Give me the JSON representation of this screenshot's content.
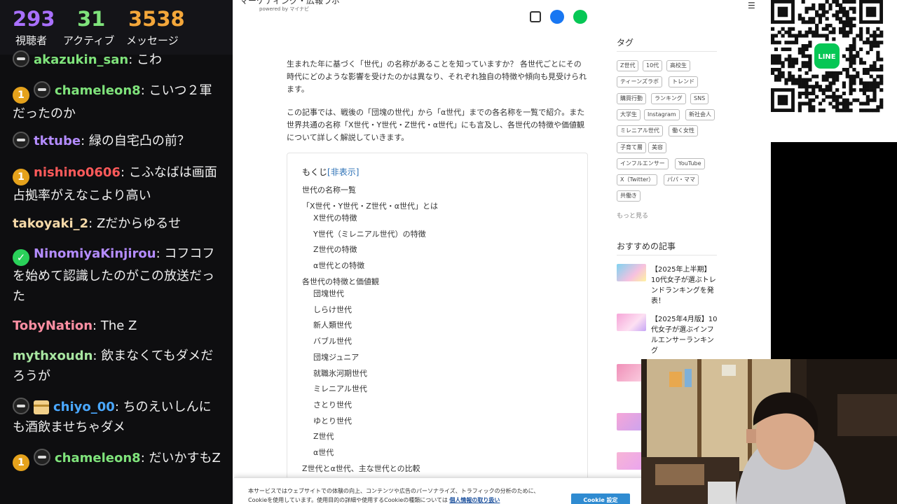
{
  "stats": [
    {
      "value": "293",
      "label": "視聴者",
      "color": "#a970ff"
    },
    {
      "value": "31",
      "label": "アクティブ",
      "color": "#7fe37b"
    },
    {
      "value": "3538",
      "label": "メッセージ",
      "color": "#f4a73a"
    }
  ],
  "chat": [
    {
      "badges": [
        "ninja-icon"
      ],
      "user": "akazukin_san",
      "color": "#7fe37b",
      "text": ": こわ"
    },
    {
      "badges": [
        "one-badge-icon",
        "ninja-icon"
      ],
      "user": "chameleon8",
      "color": "#7fe37b",
      "text": ": こいつ２軍だったのか"
    },
    {
      "badges": [
        "ninja-icon"
      ],
      "user": "tktube",
      "color": "#b48cff",
      "text": ": 緑の自宅凸の前？"
    },
    {
      "badges": [
        "one-badge-icon"
      ],
      "user": "nishino0606",
      "color": "#ff5a5a",
      "text": ": こふなばは画面占拠率がえなこより高い"
    },
    {
      "badges": [],
      "user": "takoyaki_2",
      "color": "#f5d9a8",
      "text": ": Zだからゆるせ"
    },
    {
      "badges": [
        "verified-badge-icon"
      ],
      "user": "NinomiyaKinjirou",
      "color": "#b48cff",
      "text": ": コフコフを始めて認識したのがこの放送だった"
    },
    {
      "badges": [],
      "user": "TobyNation",
      "color": "#ff8fa3",
      "text": ": The Z"
    },
    {
      "badges": [],
      "user": "mythxoudn",
      "color": "#a8e6a1",
      "text": ": 飲まなくてもダメだろうが"
    },
    {
      "badges": [
        "ninja-icon",
        "gift-icon"
      ],
      "user": "chiyo_00",
      "color": "#4aa8ff",
      "text": ": ちのえいしんにも酒飲ませちゃダメ"
    },
    {
      "badges": [
        "one-badge-icon",
        "ninja-icon"
      ],
      "user": "chameleon8",
      "color": "#7fe37b",
      "text": ": だいかすもZ"
    }
  ],
  "page": {
    "logo": "マーケティング・広報ラボ",
    "logo_sub": "powered by マイナビ",
    "intro1": "生まれた年に基づく「世代」の名称があることを知っていますか？ 各世代ごとにその時代にどのような影響を受けたのかは異なり、それぞれ独自の特徴や傾向も見受けられます。",
    "intro2": "この記事では、戦後の「団塊の世代」から「α世代」までの各名称を一覧で紹介。また世界共通の名称「X世代・Y世代・Z世代・α世代」にも言及し、各世代の特徴や価値観について詳しく解説していきます。",
    "toc_title": "もくじ",
    "toc_toggle": "[非表示]",
    "toc": [
      {
        "label": "世代の名称一覧",
        "level": 1
      },
      {
        "label": "「X世代・Y世代・Z世代・α世代」とは",
        "level": 1
      },
      {
        "label": "X世代の特徴",
        "level": 2
      },
      {
        "label": "Y世代（ミレニアル世代）の特徴",
        "level": 2
      },
      {
        "label": "Z世代の特徴",
        "level": 2
      },
      {
        "label": "α世代との特徴",
        "level": 2
      },
      {
        "label": "各世代の特徴と価値観",
        "level": 1
      },
      {
        "label": "団塊世代",
        "level": 2
      },
      {
        "label": "しらけ世代",
        "level": 2
      },
      {
        "label": "新人類世代",
        "level": 2
      },
      {
        "label": "バブル世代",
        "level": 2
      },
      {
        "label": "団塊ジュニア",
        "level": 2
      },
      {
        "label": "就職氷河期世代",
        "level": 2
      },
      {
        "label": "ミレニアル世代",
        "level": 2
      },
      {
        "label": "さとり世代",
        "level": 2
      },
      {
        "label": "ゆとり世代",
        "level": 2
      },
      {
        "label": "Z世代",
        "level": 2
      },
      {
        "label": "α世代",
        "level": 2
      },
      {
        "label": "Z世代とα世代、主な世代との比較",
        "level": 1
      }
    ],
    "tags_title": "タグ",
    "tags": [
      "Z世代",
      "10代",
      "高校生",
      "ティーンズラボ",
      "トレンド",
      "購買行動",
      "ランキング",
      "SNS",
      "大学生",
      "Instagram",
      "新社会人",
      "ミレニアル世代",
      "働く女性",
      "子育て層",
      "美容",
      "インフルエンサー",
      "YouTube",
      "X（Twitter）",
      "パパ・ママ",
      "共働き"
    ],
    "more": "もっと見る",
    "rec_title": "おすすめの記事",
    "recommended": [
      "【2025年上半期】10代女子が選ぶトレンドランキングを発表！",
      "【2025年4月版】10代女子が選ぶインフルエンサーランキング"
    ],
    "cookie_text": "本サービスではウェブサイトでの体験の向上、コンテンツや広告のパーソナライズ、トラフィックの分析のために、Cookieを使用しています。使用目的の詳細や使用するCookieの種類については",
    "cookie_link": "個人情報の取り扱い",
    "cookie_button": "Cookie 設定"
  },
  "qr": {
    "logo_text": "LINE",
    "logo_color": "#06c755"
  }
}
